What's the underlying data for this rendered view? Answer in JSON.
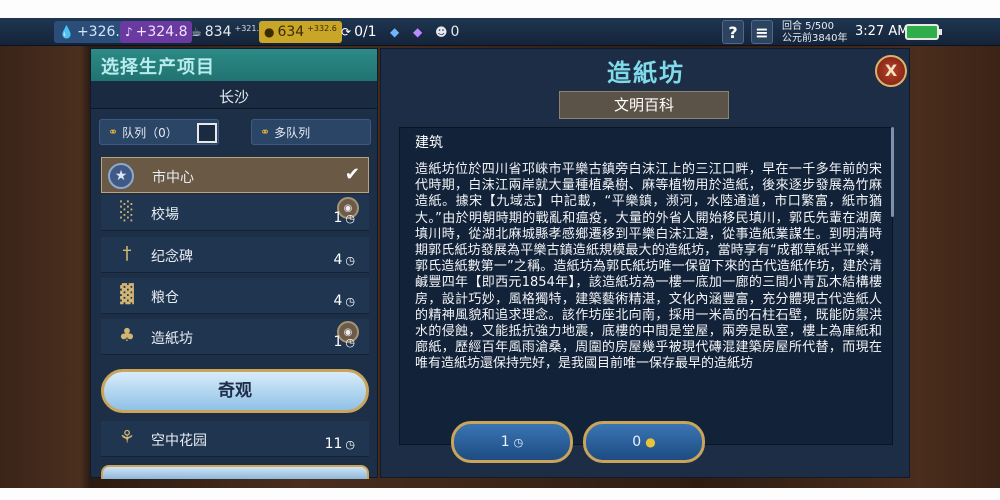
{
  "resources": {
    "science": "+326.3",
    "culture": "+324.8",
    "faith": "834",
    "faith_delta": "+321.7",
    "gold": "634",
    "gold_delta": "+332.6",
    "turns": "0/1",
    "spies": "0"
  },
  "status": {
    "turn": "回合 5/500",
    "year": "公元前3840年",
    "time": "3:27 AM"
  },
  "production_panel": {
    "title": "选择生产项目",
    "city": "长沙",
    "queue_label": "队列（0）",
    "multi_queue_label": "多队列",
    "items": [
      {
        "name": "市中心",
        "selected": true,
        "icon": "star-icon"
      },
      {
        "name": "校場",
        "turns": "1",
        "icon": "encampment-icon"
      },
      {
        "name": "纪念碑",
        "turns": "4",
        "icon": "monument-icon"
      },
      {
        "name": "粮仓",
        "turns": "4",
        "icon": "granary-icon"
      },
      {
        "name": "造紙坊",
        "turns": "1",
        "icon": "paper-mill-icon"
      }
    ],
    "wonders_label": "奇观",
    "wonder_item": {
      "name": "空中花园",
      "turns": "11",
      "icon": "garden-icon"
    }
  },
  "info_panel": {
    "title": "造紙坊",
    "tab": "文明百科",
    "section": "建筑",
    "body": "造紙坊位於四川省邛崍市平樂古鎮旁白沫江上的三江口畔，早在一千多年前的宋代時期，白沫江兩岸就大量種植桑樹、麻等植物用於造紙，後來逐步發展為竹麻造紙。據宋【九域志】中記載，“平樂鎮，濒河，水陸通道，市口繁富，紙市猶大。”由於明朝時期的戰亂和瘟疫，大量的外省人開始移民填川，郭氏先輩在湖廣填川時，從湖北麻城縣孝感鄉遷移到平樂白沫江邊，從事造紙業謀生。到明清時期郭氏紙坊發展為平樂古鎮造紙規模最大的造紙坊，當時享有“成都草紙半平樂，郭氏造紙數第一”之稱。造紙坊為郭氏紙坊唯一保留下來的古代造紙作坊，建於清鹹豐四年【即西元1854年】，該造紙坊為一樓一底加一廊的三間小青瓦木結構樓房，設計巧妙，風格獨特，建築藝術精湛，文化內涵豐富，充分體現古代造紙人的精神風貌和追求理念。該作坊座北向南，採用一米高的石柱石壁，既能防禦洪水的侵蝕，又能抵抗強力地震，底樓的中間是堂屋，兩旁是臥室，樓上為庫紙和廊紙，歷經百年風雨滄桑，周圍的房屋幾乎被現代磚混建築房屋所代替，而現在唯有造紙坊還保持完好，是我國目前唯一保存最早的造紙坊",
    "buy_turns": "1",
    "buy_gold": "0"
  }
}
